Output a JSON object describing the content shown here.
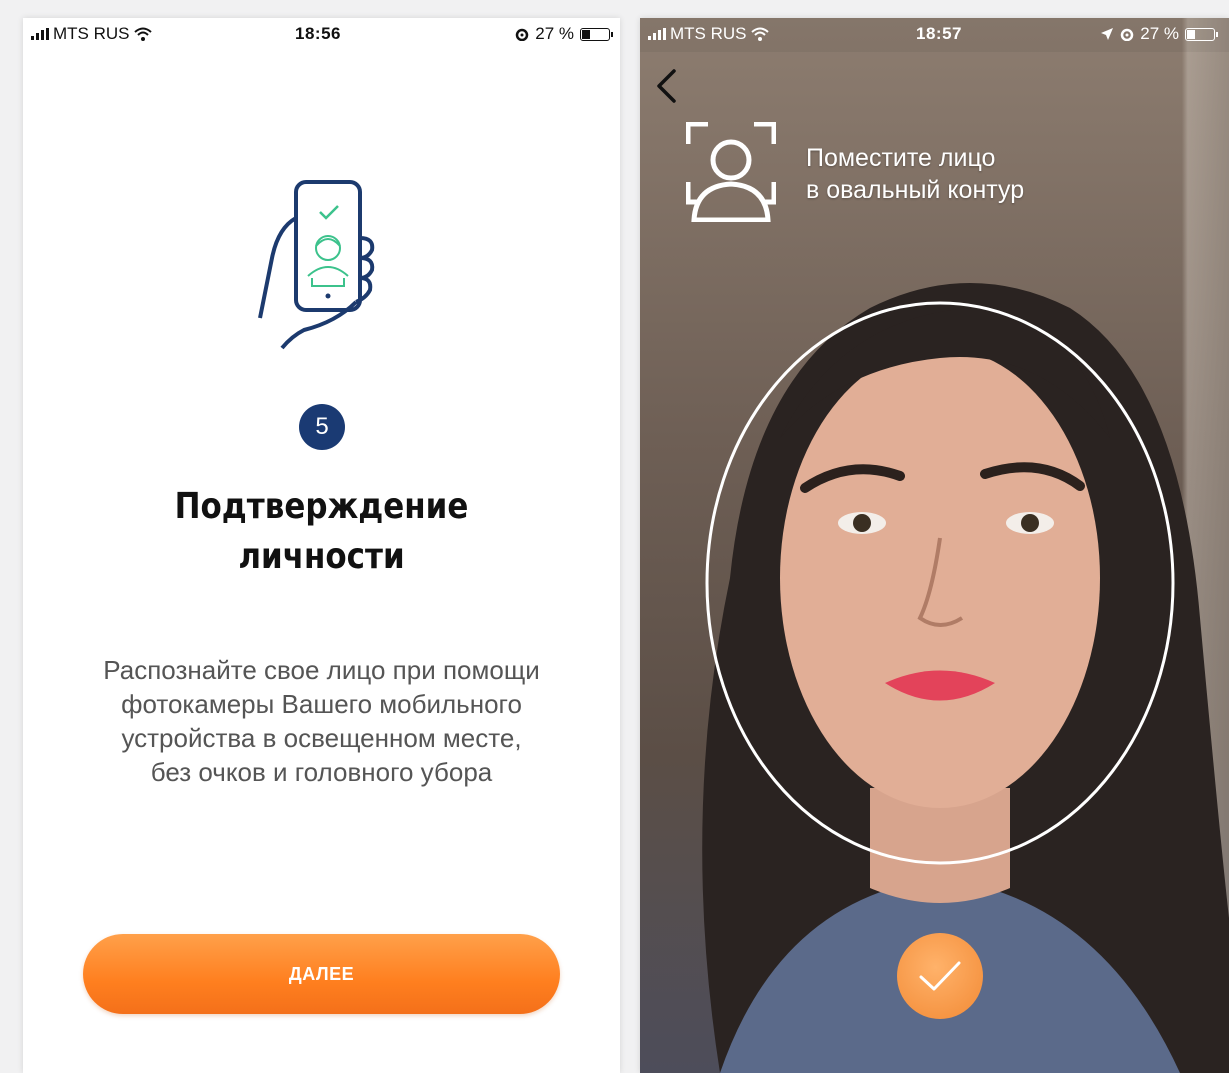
{
  "left_screen": {
    "status_bar": {
      "carrier": "MTS RUS",
      "time": "18:56",
      "battery": "27 %",
      "battery_level": 0.27
    },
    "step_number": "5",
    "title": "Подтверждение\nличности",
    "description": "Распознайте свое лицо при помощи\nфотокамеры Вашего мобильного\nустройства в освещенном месте,\nбез очков и головного убора",
    "next_button_label": "ДАЛЕЕ",
    "icons": [
      "phone-hand-face-icon",
      "alarm-icon",
      "wifi-icon",
      "signal-icon",
      "battery-icon"
    ]
  },
  "right_screen": {
    "status_bar": {
      "carrier": "MTS RUS",
      "time": "18:57",
      "battery": "27 %",
      "battery_level": 0.27
    },
    "instruction": "Поместите лицо\nв овальный контур",
    "icons": [
      "back-chevron-icon",
      "face-frame-icon",
      "location-arrow-icon",
      "alarm-icon",
      "checkmark-icon"
    ]
  },
  "colors": {
    "accent_orange": "#ff8a2a",
    "badge_blue": "#1a3a73",
    "illustration_blue": "#1c3a6e",
    "illustration_green": "#3cc28c"
  }
}
